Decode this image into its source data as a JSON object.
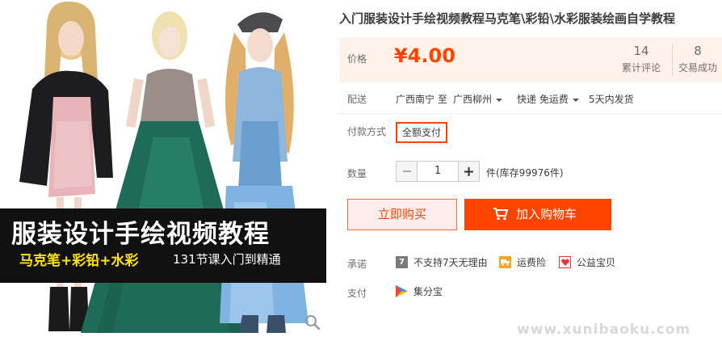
{
  "gallery": {
    "banner_title": "服装设计手绘视频教程",
    "banner_subtitle": "马克笔+彩铅+水彩",
    "banner_subtitle2": "131节课入门到精通",
    "zoom_icon": "magnifier-icon"
  },
  "product": {
    "title": "入门服装设计手绘视频教程马克笔\\彩铅\\水彩服装绘画自学教程"
  },
  "price": {
    "label": "价格",
    "value": "¥4.00",
    "reviews_count": "14",
    "reviews_label": "累计评论",
    "sales_count": "8",
    "sales_label": "交易成功",
    "color": "#ff4400"
  },
  "delivery": {
    "label": "配送",
    "from": "广西南宁 至",
    "to": "广西柳州",
    "shipping": "快递 免运费",
    "ship_time": "5天内发货"
  },
  "payment_method": {
    "label": "付款方式",
    "option": "全额支付"
  },
  "quantity": {
    "label": "数量",
    "value": "1",
    "unit": "件(库存99976件)",
    "minus_icon": "minus-icon",
    "plus_icon": "plus-icon"
  },
  "actions": {
    "buy_now": "立即购买",
    "add_to_cart": "加入购物车",
    "cart_icon": "cart-icon"
  },
  "promises": {
    "label": "承诺",
    "items": [
      "不支持7天无理由",
      "运费险",
      "公益宝贝"
    ]
  },
  "pay": {
    "label": "支付",
    "method": "集分宝"
  },
  "watermark": "www.xunibaoku.com"
}
